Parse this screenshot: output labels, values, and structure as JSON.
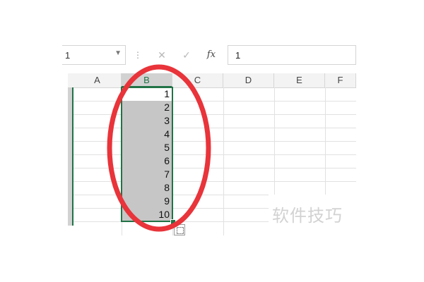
{
  "formula_bar": {
    "name_box_value": "1",
    "separator": "⋮",
    "cancel_symbol": "✕",
    "enter_symbol": "✓",
    "fx_label": "fx",
    "formula_value": "1"
  },
  "columns": [
    "A",
    "B",
    "C",
    "D",
    "E",
    "F"
  ],
  "selected_column": "B",
  "column_b_values": [
    "1",
    "2",
    "3",
    "4",
    "5",
    "6",
    "7",
    "8",
    "9",
    "10"
  ],
  "annotation": {
    "color": "#e8343a"
  },
  "watermark": {
    "text": "软件技巧"
  },
  "colors": {
    "excel_green": "#217346",
    "selection_fill": "#c6c6c6",
    "header_fill": "#f3f3f3"
  }
}
